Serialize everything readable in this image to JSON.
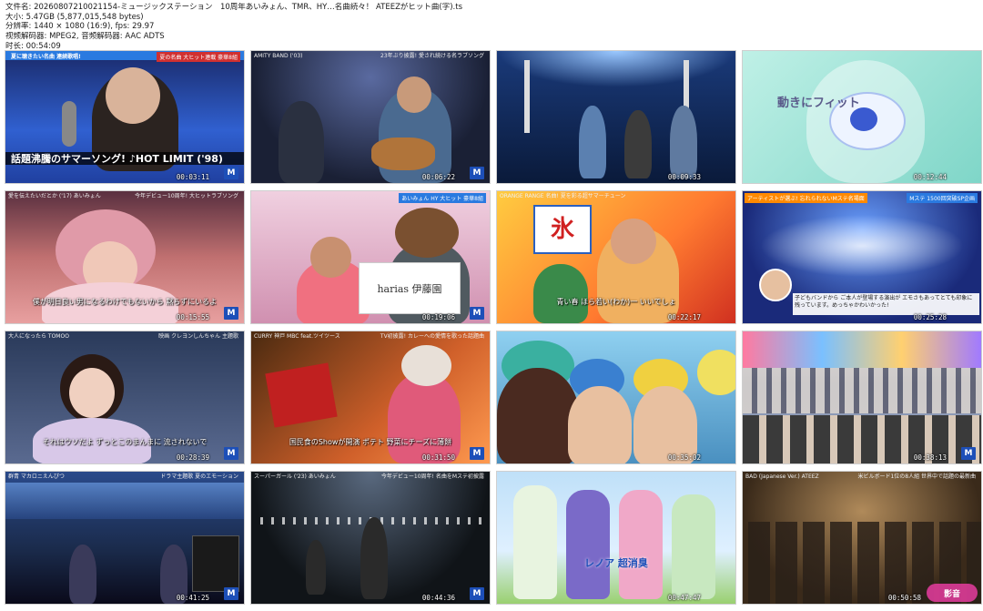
{
  "info": {
    "filename": "文件名: 20260807210021154-ミュージックステーション　10周年あいみょん、TMR、HY…名曲続々！ ATEEZがヒット曲(字).ts",
    "size": "大小: 5.47GB (5,877,015,548 bytes)",
    "resolution": "分辨率: 1440 × 1080 (16:9), fps: 29.97",
    "codec": "视频解码器: MPEG2, 音频解码器: AAC ADTS",
    "duration": "时长: 00:54:09"
  },
  "thumbs": [
    {
      "time": "00:03:11",
      "top_left": "夏に聴きたい名曲 連続歌唱!",
      "top_right": "夏の名曲 大ヒット連載 豪華8組",
      "caption": "話題沸騰のサマーソング! ♪HOT LIMIT ('98)",
      "logo": "M"
    },
    {
      "time": "00:06:22",
      "top_left": "AMITY BAND ('03)",
      "top_right": "23年ぶり披露! 愛され続ける名ラブソング",
      "caption": "",
      "logo": "M"
    },
    {
      "time": "00:09:33",
      "top_left": "",
      "top_right": "",
      "caption": "",
      "logo": ""
    },
    {
      "time": "00:12:44",
      "top_left": "",
      "top_right": "",
      "caption": "動きにフィット",
      "logo": ""
    },
    {
      "time": "00:15:55",
      "top_left": "愛を伝えたいだとか ('17) あいみょん",
      "top_right": "今年デビュー10周年! 大ヒットラブソング",
      "caption": "僕が明日良い男になるわけでもないから 黙らずにいるよ",
      "logo": "M"
    },
    {
      "time": "00:19:06",
      "top_left": "",
      "top_right": "あいみょん HY 大ヒット 豪華8組",
      "caption": "harias 伊藤園",
      "logo": "M"
    },
    {
      "time": "00:22:17",
      "top_left": "ORANGE RANGE 名曲! 夏を彩る超サマーチューン",
      "top_right": "",
      "caption": "青い春 ほら若い(わか)一 いいでしょ",
      "logo": ""
    },
    {
      "time": "00:25:28",
      "top_left": "アーティストが選ぶ! 忘れられないMステ名場面",
      "top_right": "Mステ 1500回突破SP企画",
      "caption": "子どもバンドから ご本人が登場する演出が エモさもあってとても印象に残っています。めっちゃかわいかった!",
      "logo": ""
    },
    {
      "time": "00:28:39",
      "top_left": "大人になったら TOMOO",
      "top_right": "映画 クレヨンしんちゃん 主題歌",
      "caption": "それはウソだよ ずっとこのまんまに 流されないで",
      "logo": "M"
    },
    {
      "time": "00:31:50",
      "top_left": "CURRY 神戸 MBC feat.ツイツース",
      "top_right": "TV初披露! カレーへの愛情を歌った話題曲",
      "caption": "国民食のShowが開演 ポテト 野菜にチーズに薄餅",
      "logo": "M"
    },
    {
      "time": "00:35:02",
      "top_left": "",
      "top_right": "",
      "caption": "",
      "logo": ""
    },
    {
      "time": "00:38:13",
      "top_left": "",
      "top_right": "",
      "caption": "",
      "logo": "M"
    },
    {
      "time": "00:41:25",
      "top_left": "群青 マカロニえんぴつ",
      "top_right": "ドラマ主題歌 夏のエモーション",
      "caption": "",
      "logo": "M"
    },
    {
      "time": "00:44:36",
      "top_left": "スーパーガール ('23) あいみょん",
      "top_right": "今年デビュー10周年! 名曲をMステ初披露",
      "caption": "",
      "logo": "M"
    },
    {
      "time": "00:47:47",
      "top_left": "",
      "top_right": "",
      "caption": "レノア 超消臭",
      "logo": ""
    },
    {
      "time": "00:50:58",
      "top_left": "BAD (Japanese Ver.) ATEEZ",
      "top_right": "米ビルボード1位の8人組 世界中で話題の最新曲",
      "caption": "",
      "logo": ""
    }
  ],
  "colors": {
    "page_bg": "#ffffff",
    "mstation_blue": "#1d4fb8",
    "banner_orange": "#ff8a00",
    "watermark_pink": "#e63ca0"
  },
  "watermark": {
    "label": "影音"
  }
}
